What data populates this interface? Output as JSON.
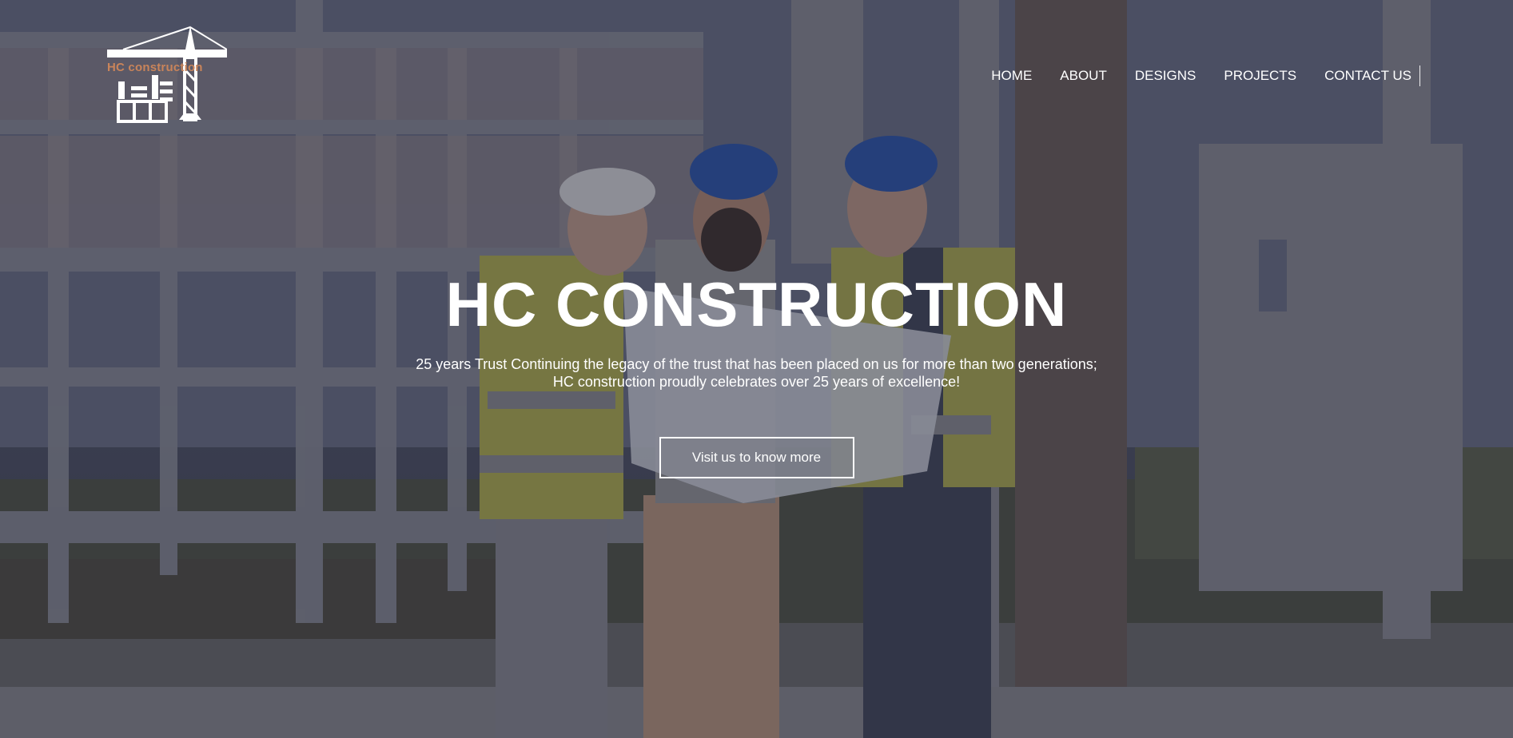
{
  "brand": {
    "logo_text": "HC construction",
    "logo_color": "#c9845a"
  },
  "nav": {
    "items": [
      {
        "label": "HOME"
      },
      {
        "label": "ABOUT"
      },
      {
        "label": "DESIGNS"
      },
      {
        "label": "PROJECTS"
      },
      {
        "label": "CONTACT US"
      }
    ]
  },
  "hero": {
    "title": "HC CONSTRUCTION",
    "subtitle_line1": "25 years Trust Continuing the legacy of the trust that has been placed on us for more than two generations;",
    "subtitle_line2": "HC construction proudly celebrates over 25 years of excellence!",
    "cta_label": "Visit us to know more"
  },
  "colors": {
    "text": "#ffffff",
    "overlay": "#26283a"
  }
}
